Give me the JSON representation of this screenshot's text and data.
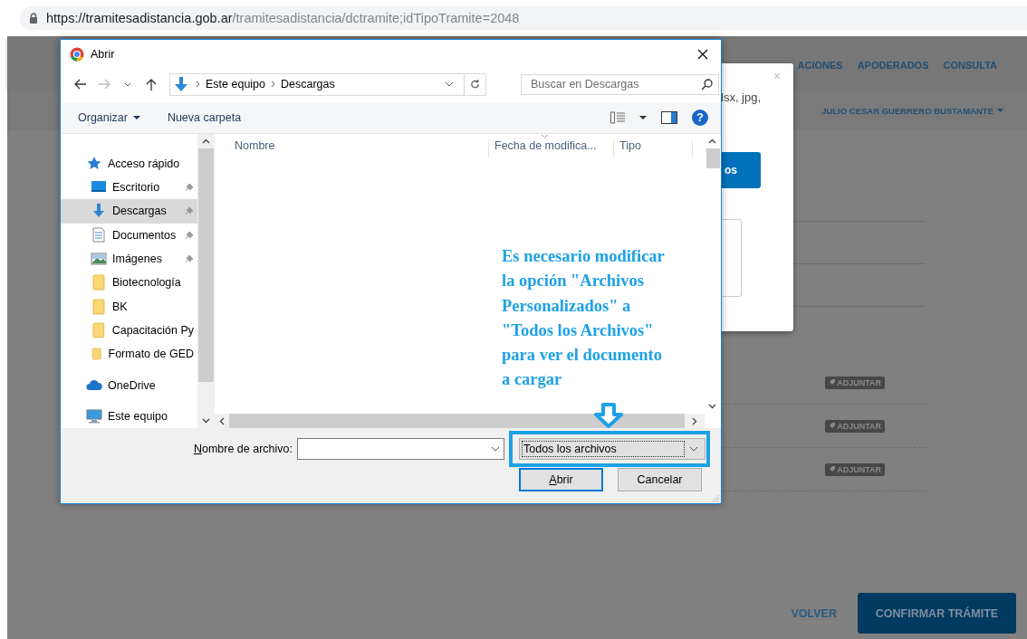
{
  "address_bar": {
    "host": "https://tramitesadistancia.gob.ar",
    "path": "/tramitesadistancia/dctramite;idTipoTramite=2048"
  },
  "page": {
    "nav": [
      "ACIONES",
      "APODERADOS",
      "CONSULTA"
    ],
    "user": "JULIO CESAR GUERRERO BUSTAMANTE",
    "attach_buttons": [
      "ADJUNTAR",
      "ADJUNTAR",
      "ADJUNTAR"
    ],
    "back_link": "VOLVER",
    "confirm_button": "CONFIRMAR TRÁMITE"
  },
  "modal": {
    "close": "×",
    "text": "lsx, jpg,",
    "button": "os"
  },
  "dialog": {
    "title": "Abrir",
    "breadcrumb": [
      "Este equipo",
      "Descargas"
    ],
    "search": {
      "placeholder": "Buscar en Descargas"
    },
    "toolbar": {
      "organize": "Organizar",
      "new_folder": "Nueva carpeta",
      "help": "?"
    },
    "nav_items": [
      {
        "label": "Acceso rápido",
        "kind": "group",
        "pinned": false,
        "selected": false
      },
      {
        "label": "Escritorio",
        "kind": "item",
        "pinned": true,
        "selected": false
      },
      {
        "label": "Descargas",
        "kind": "item",
        "pinned": true,
        "selected": true
      },
      {
        "label": "Documentos",
        "kind": "item",
        "pinned": true,
        "selected": false
      },
      {
        "label": "Imágenes",
        "kind": "item",
        "pinned": true,
        "selected": false
      },
      {
        "label": "Biotecnología",
        "kind": "item",
        "pinned": false,
        "selected": false
      },
      {
        "label": "BK",
        "kind": "item",
        "pinned": false,
        "selected": false
      },
      {
        "label": "Capacitación Py",
        "kind": "item",
        "pinned": false,
        "selected": false
      },
      {
        "label": "Formato de GED",
        "kind": "item",
        "pinned": false,
        "selected": false
      },
      {
        "label": "OneDrive",
        "kind": "group",
        "pinned": false,
        "selected": false
      },
      {
        "label": "Este equipo",
        "kind": "group",
        "pinned": false,
        "selected": false
      }
    ],
    "columns": [
      "Nombre",
      "Fecha de modifica...",
      "Tipo"
    ],
    "filename": {
      "label": "Nombre de archivo:"
    },
    "filetype": "Todos los archivos",
    "buttons": [
      "Abrir",
      "Cancelar"
    ]
  },
  "annotation": {
    "lines": [
      "Es necesario modificar",
      "la opción \"Archivos",
      "Personalizados\" a",
      "\"Todos los Archivos\"",
      "para ver el documento",
      "a cargar"
    ]
  }
}
